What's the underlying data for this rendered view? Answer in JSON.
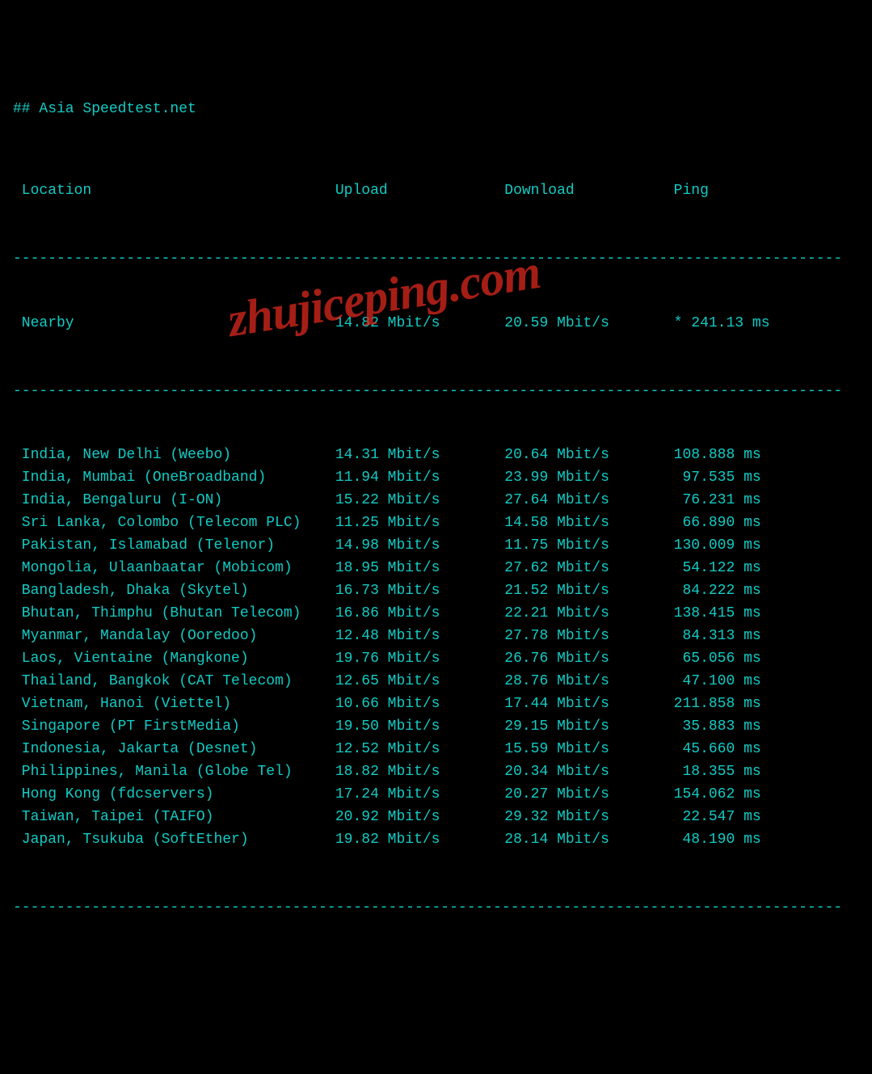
{
  "title": "## Asia Speedtest.net",
  "header": {
    "location": " Location",
    "upload": "Upload",
    "download": "Download",
    "ping": "Ping"
  },
  "nearby": {
    "location": " Nearby",
    "upload": "14.82 Mbit/s",
    "download": "20.59 Mbit/s",
    "ping": "* 241.13 ms"
  },
  "rows": [
    {
      "location": " India, New Delhi (Weebo)",
      "upload": "14.31 Mbit/s",
      "download": "20.64 Mbit/s",
      "ping": "108.888 ms"
    },
    {
      "location": " India, Mumbai (OneBroadband)",
      "upload": "11.94 Mbit/s",
      "download": "23.99 Mbit/s",
      "ping": " 97.535 ms"
    },
    {
      "location": " India, Bengaluru (I-ON)",
      "upload": "15.22 Mbit/s",
      "download": "27.64 Mbit/s",
      "ping": " 76.231 ms"
    },
    {
      "location": " Sri Lanka, Colombo (Telecom PLC)",
      "upload": "11.25 Mbit/s",
      "download": "14.58 Mbit/s",
      "ping": " 66.890 ms"
    },
    {
      "location": " Pakistan, Islamabad (Telenor)",
      "upload": "14.98 Mbit/s",
      "download": "11.75 Mbit/s",
      "ping": "130.009 ms"
    },
    {
      "location": " Mongolia, Ulaanbaatar (Mobicom)",
      "upload": "18.95 Mbit/s",
      "download": "27.62 Mbit/s",
      "ping": " 54.122 ms"
    },
    {
      "location": " Bangladesh, Dhaka (Skytel)",
      "upload": "16.73 Mbit/s",
      "download": "21.52 Mbit/s",
      "ping": " 84.222 ms"
    },
    {
      "location": " Bhutan, Thimphu (Bhutan Telecom)",
      "upload": "16.86 Mbit/s",
      "download": "22.21 Mbit/s",
      "ping": "138.415 ms"
    },
    {
      "location": " Myanmar, Mandalay (Ooredoo)",
      "upload": "12.48 Mbit/s",
      "download": "27.78 Mbit/s",
      "ping": " 84.313 ms"
    },
    {
      "location": " Laos, Vientaine (Mangkone)",
      "upload": "19.76 Mbit/s",
      "download": "26.76 Mbit/s",
      "ping": " 65.056 ms"
    },
    {
      "location": " Thailand, Bangkok (CAT Telecom)",
      "upload": "12.65 Mbit/s",
      "download": "28.76 Mbit/s",
      "ping": " 47.100 ms"
    },
    {
      "location": " Vietnam, Hanoi (Viettel)",
      "upload": "10.66 Mbit/s",
      "download": "17.44 Mbit/s",
      "ping": "211.858 ms"
    },
    {
      "location": " Singapore (PT FirstMedia)",
      "upload": "19.50 Mbit/s",
      "download": "29.15 Mbit/s",
      "ping": " 35.883 ms"
    },
    {
      "location": " Indonesia, Jakarta (Desnet)",
      "upload": "12.52 Mbit/s",
      "download": "15.59 Mbit/s",
      "ping": " 45.660 ms"
    },
    {
      "location": " Philippines, Manila (Globe Tel)",
      "upload": "18.82 Mbit/s",
      "download": "20.34 Mbit/s",
      "ping": " 18.355 ms"
    },
    {
      "location": " Hong Kong (fdcservers)",
      "upload": "17.24 Mbit/s",
      "download": "20.27 Mbit/s",
      "ping": "154.062 ms"
    },
    {
      "location": " Taiwan, Taipei (TAIFO)",
      "upload": "20.92 Mbit/s",
      "download": "29.32 Mbit/s",
      "ping": " 22.547 ms"
    },
    {
      "location": " Japan, Tsukuba (SoftEther)",
      "upload": "19.82 Mbit/s",
      "download": "28.14 Mbit/s",
      "ping": " 48.190 ms"
    }
  ],
  "separator": "-----------------------------------------------------------------------------------------------",
  "watermark": "zhujiceping.com",
  "chart_data": {
    "type": "table",
    "title": "Asia Speedtest.net",
    "columns": [
      "Location",
      "Upload (Mbit/s)",
      "Download (Mbit/s)",
      "Ping (ms)"
    ],
    "data": [
      [
        "Nearby",
        14.82,
        20.59,
        241.13
      ],
      [
        "India, New Delhi (Weebo)",
        14.31,
        20.64,
        108.888
      ],
      [
        "India, Mumbai (OneBroadband)",
        11.94,
        23.99,
        97.535
      ],
      [
        "India, Bengaluru (I-ON)",
        15.22,
        27.64,
        76.231
      ],
      [
        "Sri Lanka, Colombo (Telecom PLC)",
        11.25,
        14.58,
        66.89
      ],
      [
        "Pakistan, Islamabad (Telenor)",
        14.98,
        11.75,
        130.009
      ],
      [
        "Mongolia, Ulaanbaatar (Mobicom)",
        18.95,
        27.62,
        54.122
      ],
      [
        "Bangladesh, Dhaka (Skytel)",
        16.73,
        21.52,
        84.222
      ],
      [
        "Bhutan, Thimphu (Bhutan Telecom)",
        16.86,
        22.21,
        138.415
      ],
      [
        "Myanmar, Mandalay (Ooredoo)",
        12.48,
        27.78,
        84.313
      ],
      [
        "Laos, Vientaine (Mangkone)",
        19.76,
        26.76,
        65.056
      ],
      [
        "Thailand, Bangkok (CAT Telecom)",
        12.65,
        28.76,
        47.1
      ],
      [
        "Vietnam, Hanoi (Viettel)",
        10.66,
        17.44,
        211.858
      ],
      [
        "Singapore (PT FirstMedia)",
        19.5,
        29.15,
        35.883
      ],
      [
        "Indonesia, Jakarta (Desnet)",
        12.52,
        15.59,
        45.66
      ],
      [
        "Philippines, Manila (Globe Tel)",
        18.82,
        20.34,
        18.355
      ],
      [
        "Hong Kong (fdcservers)",
        17.24,
        20.27,
        154.062
      ],
      [
        "Taiwan, Taipei (TAIFO)",
        20.92,
        29.32,
        22.547
      ],
      [
        "Japan, Tsukuba (SoftEther)",
        19.82,
        28.14,
        48.19
      ]
    ]
  }
}
